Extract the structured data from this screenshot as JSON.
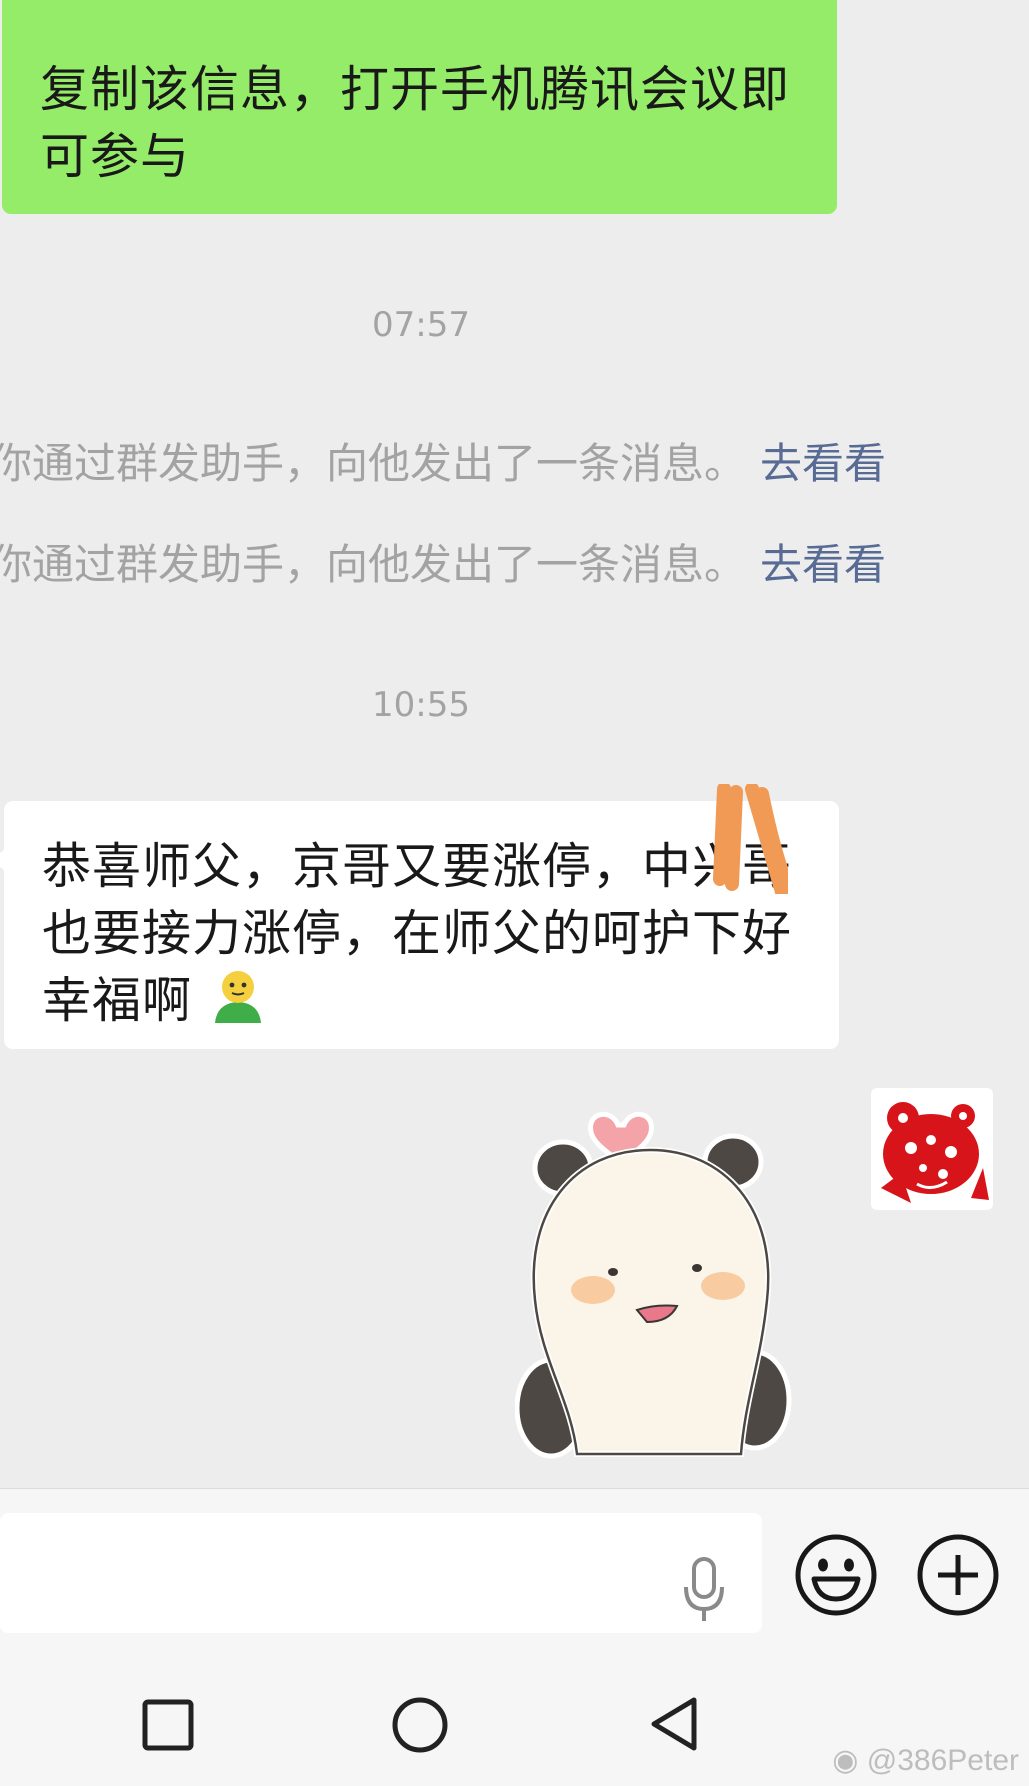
{
  "messages": {
    "outgoing_text": "复制该信息，打开手机腾讯会议即可参与",
    "time_1": "07:57",
    "system_1": "你通过群发助手，向他发出了一条消息。",
    "system_2": "你通过群发助手，向他发出了一条消息。",
    "system_link": "去看看",
    "time_2": "10:55",
    "incoming_text": "恭喜师父，京哥又要涨停，中兴哥也要接力涨停，在师父的呵护下好幸福啊"
  },
  "icons": {
    "inline_emoji": "smiling-person-emoji",
    "avatar": "red-papercut-avatar",
    "sticker": "panda-heart-sticker",
    "input_voice": "microphone-icon",
    "emoji": "smiley-face-icon",
    "more": "plus-circle-icon",
    "nav_recent": "square-icon",
    "nav_home": "circle-icon",
    "nav_back": "triangle-back-icon"
  },
  "colors": {
    "outgoing_bubble": "#95ec69",
    "incoming_bubble": "#ffffff",
    "link": "#576b95",
    "background": "#ededed"
  },
  "watermark": "@386Peter"
}
